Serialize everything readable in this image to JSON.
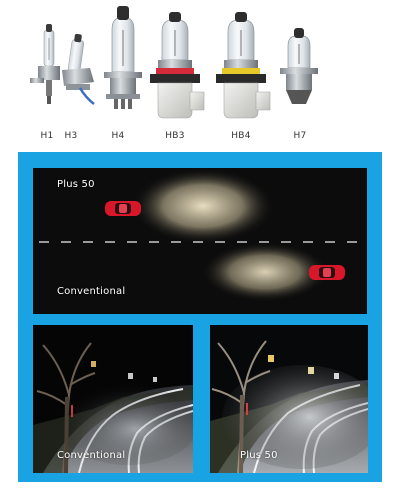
{
  "bulb_labels": [
    "H1",
    "H3",
    "H4",
    "HB3",
    "HB4",
    "H7"
  ],
  "comparison": {
    "top_label": "Plus 50",
    "bottom_label": "Conventional"
  },
  "photos": {
    "left_caption": "Conventional",
    "right_caption": "Plus 50"
  },
  "colors": {
    "frame": "#1aa3e3",
    "night": "#0c0c0c",
    "car": "#d8182a",
    "beam": "#efe4c6"
  }
}
